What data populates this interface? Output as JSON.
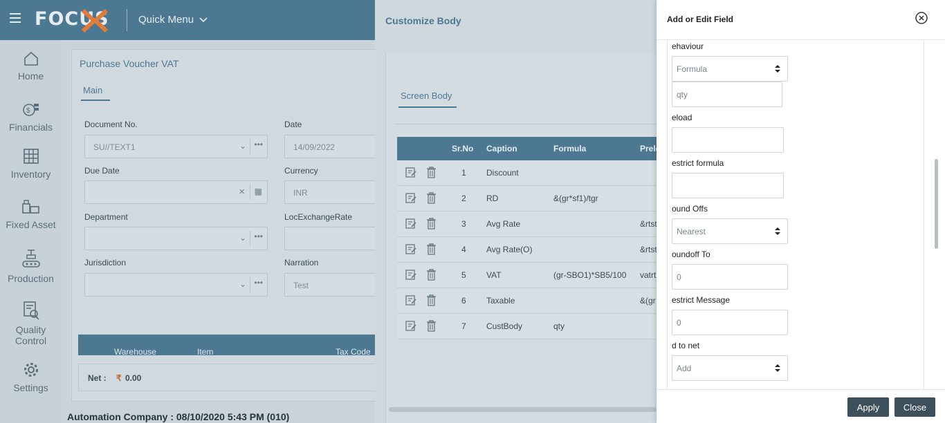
{
  "header": {
    "logo": "FOCUS",
    "quick_menu": "Quick Menu"
  },
  "sidebar": {
    "items": [
      {
        "label": "Home",
        "icon": "home-icon"
      },
      {
        "label": "Financials",
        "icon": "financials-icon"
      },
      {
        "label": "Inventory",
        "icon": "inventory-icon"
      },
      {
        "label": "Fixed Asset",
        "icon": "fixed-asset-icon"
      },
      {
        "label": "Production",
        "icon": "production-icon"
      },
      {
        "label": "Quality Control",
        "icon": "quality-control-icon"
      },
      {
        "label": "Settings",
        "icon": "gear-icon"
      }
    ]
  },
  "voucher": {
    "title": "Purchase Voucher VAT",
    "tab": "Main",
    "document_no_label": "Document No.",
    "document_no_value": "SU//TEXT1",
    "date_label": "Date",
    "date_value": "14/09/2022",
    "due_date_label": "Due Date",
    "currency_label": "Currency",
    "currency_value": "INR",
    "department_label": "Department",
    "loc_exchange_label": "LocExchangeRate",
    "jurisdiction_label": "Jurisdiction",
    "narration_label": "Narration",
    "narration_value": "Test",
    "grid_columns": [
      "Warehouse",
      "Item",
      "Tax Code"
    ],
    "net_label": "Net :",
    "net_currency": "₹",
    "net_value": "0.00"
  },
  "status_bar": "Automation Company : 08/10/2020 5:43 PM (010)",
  "customize_body": {
    "title": "Customize Body",
    "tab": "Screen Body",
    "columns": [
      "Sr.No",
      "Caption",
      "Formula",
      "Prelc"
    ],
    "rows": [
      {
        "sr": "1",
        "caption": "Discount",
        "formula": "",
        "preload": ""
      },
      {
        "sr": "2",
        "caption": "RD",
        "formula": "&(gr*sf1)/tgr",
        "preload": ""
      },
      {
        "sr": "3",
        "caption": "Avg Rate",
        "formula": "",
        "preload": "&rtst"
      },
      {
        "sr": "4",
        "caption": "Avg Rate(O)",
        "formula": "",
        "preload": "&rtst"
      },
      {
        "sr": "5",
        "caption": "VAT",
        "formula": "(gr-SBO1)*SB5/100",
        "preload": "vatrt"
      },
      {
        "sr": "6",
        "caption": "Taxable",
        "formula": "",
        "preload": "&(gr"
      },
      {
        "sr": "7",
        "caption": "CustBody",
        "formula": "qty",
        "preload": ""
      }
    ]
  },
  "drawer": {
    "title": "Add or Edit Field",
    "behaviour_label": "ehaviour",
    "behaviour_value": "Formula",
    "formula_value": "qty",
    "preload_label": "eload",
    "restrict_formula_label": "estrict formula",
    "round_offs_label": "ound Offs",
    "round_offs_value": "Nearest",
    "roundoff_to_label": "oundoff To",
    "roundoff_to_value": "0",
    "restrict_message_label": "estrict Message",
    "restrict_message_value": "0",
    "add_to_net_label": "d to net",
    "add_to_net_value": "Add",
    "apply_label": "Apply",
    "close_label": "Close"
  }
}
